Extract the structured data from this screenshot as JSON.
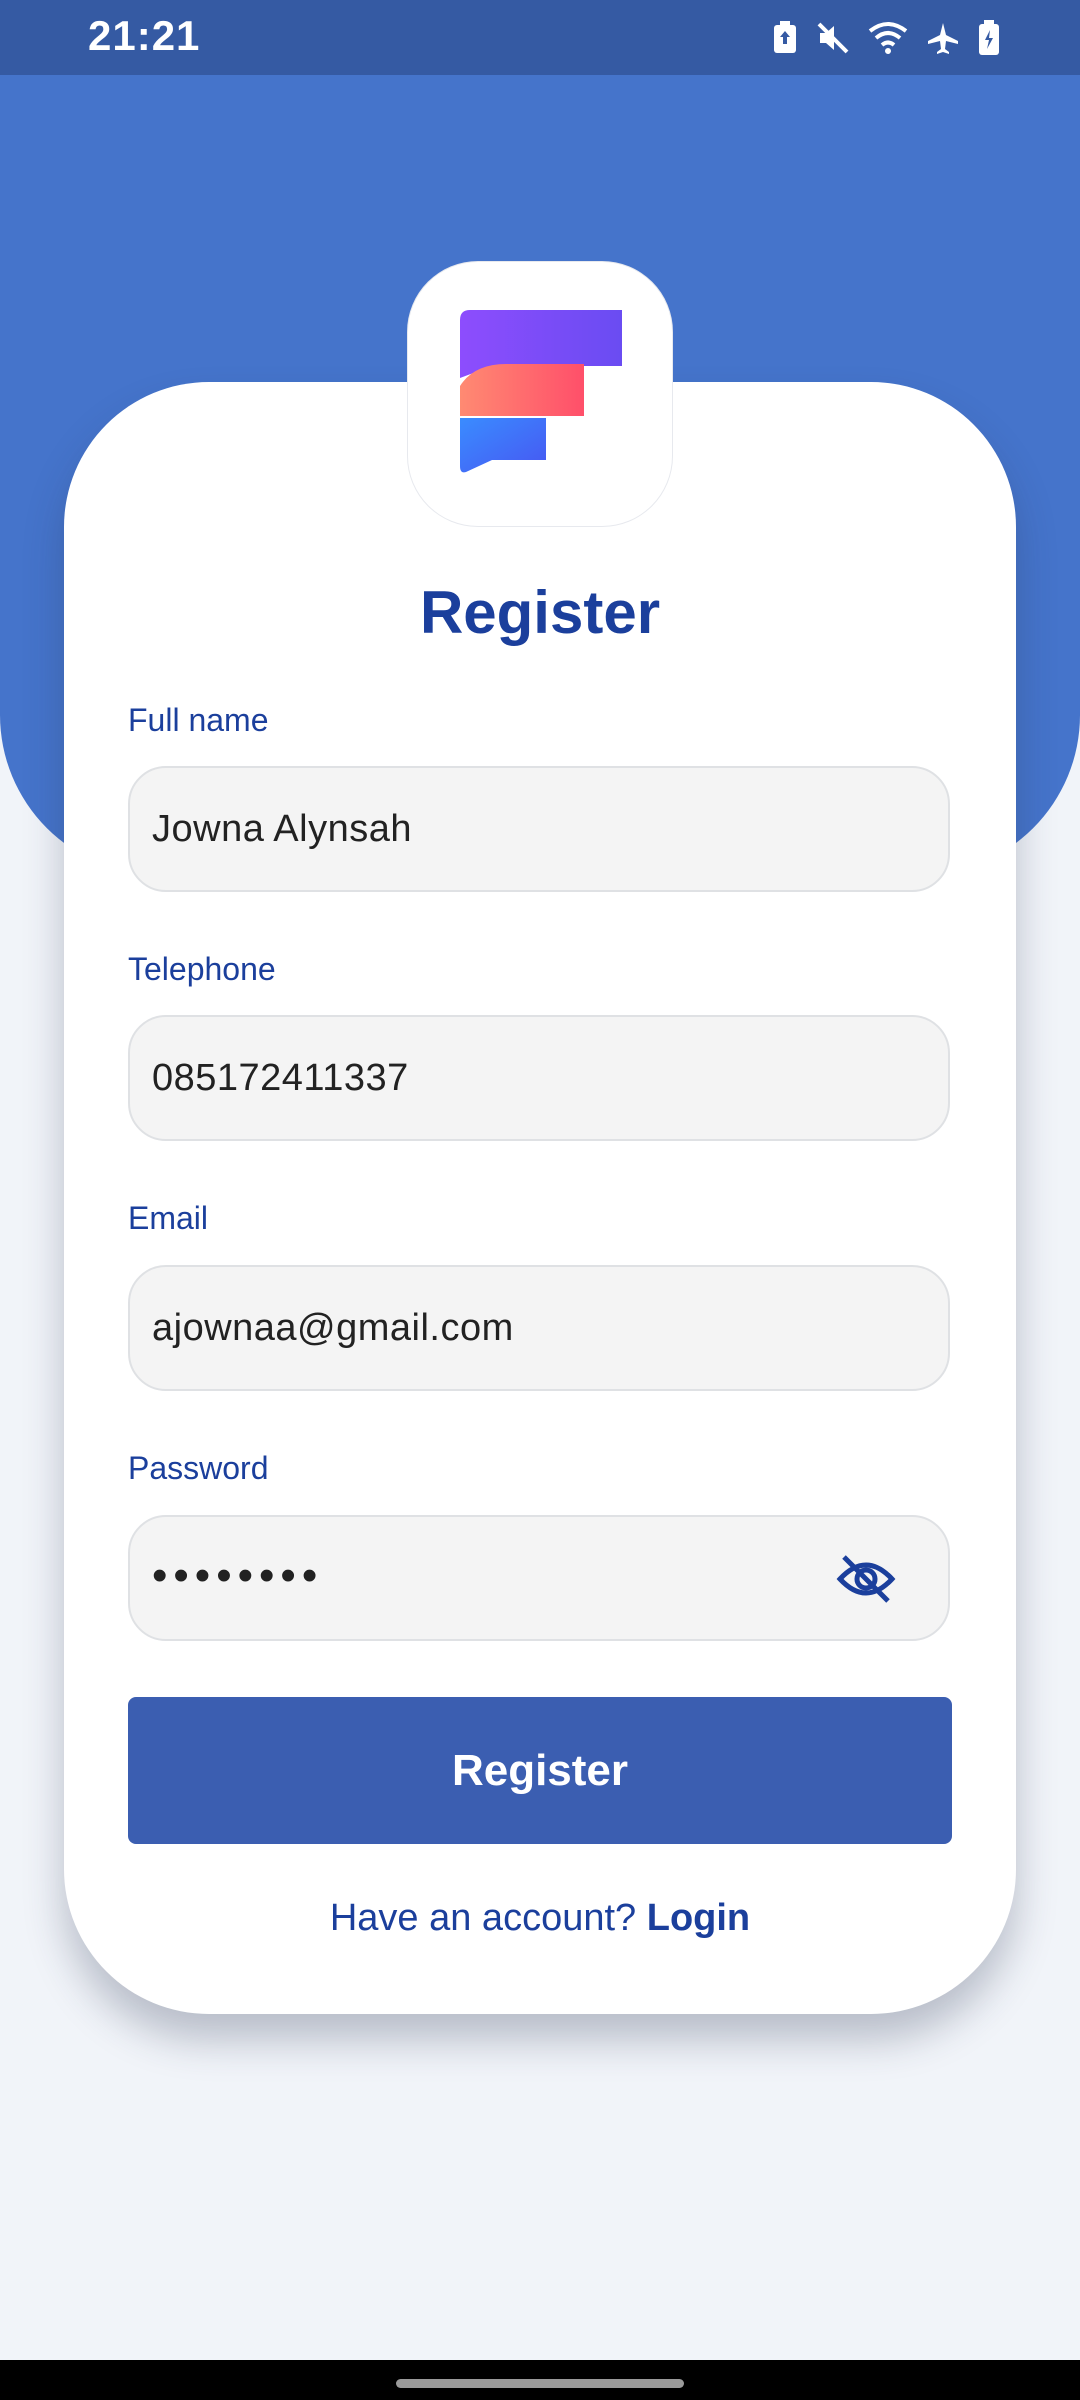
{
  "status_bar": {
    "time": "21:21",
    "icons": [
      "battery-saver-icon",
      "mute-icon",
      "wifi-icon",
      "airplane-icon",
      "battery-charging-icon"
    ]
  },
  "app": {
    "logo": "app-logo",
    "title": "Register"
  },
  "form": {
    "full_name": {
      "label": "Full name",
      "value": "Jowna Alynsah"
    },
    "telephone": {
      "label": "Telephone",
      "value": "085172411337"
    },
    "email": {
      "label": "Email",
      "value": "ajownaa@gmail.com"
    },
    "password": {
      "label": "Password",
      "value": "••••••••",
      "toggle_icon": "eye-off-icon"
    }
  },
  "actions": {
    "register_button": "Register",
    "account_prompt": "Have an account?",
    "login_link": "Login"
  },
  "colors": {
    "header_blue": "#4574cb",
    "status_bar": "#355aa3",
    "primary_text": "#1b3f9c",
    "button": "#3b5eb1",
    "background": "#f1f4f9"
  }
}
